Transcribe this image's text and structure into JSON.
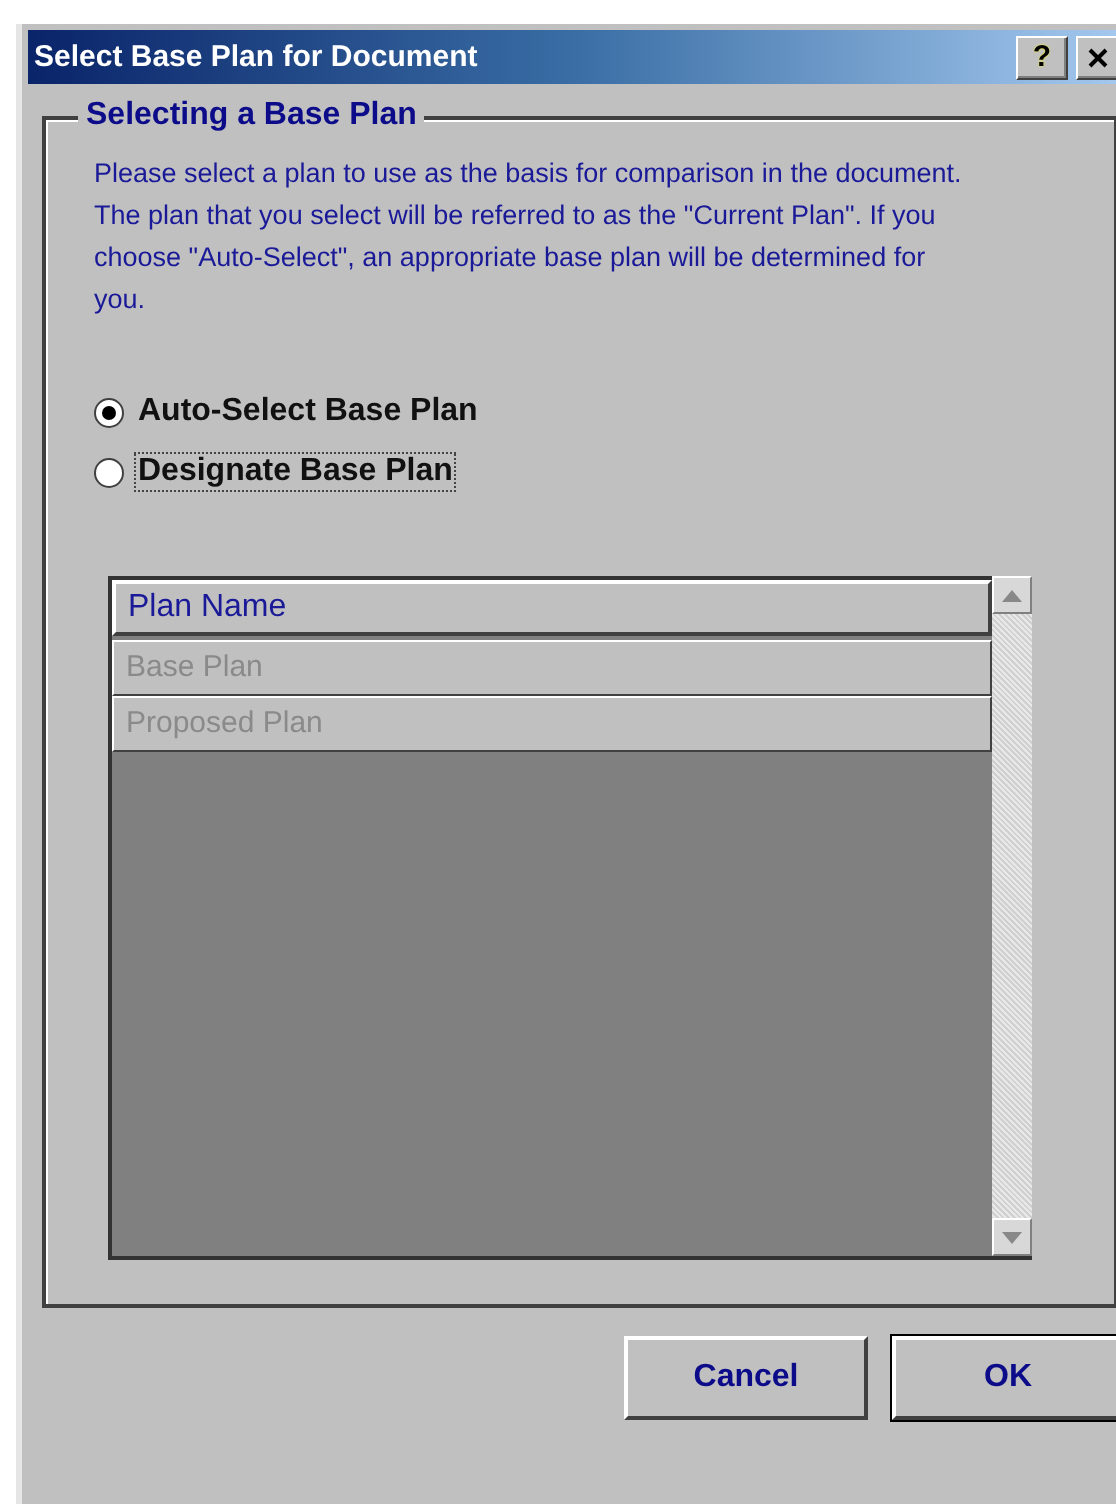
{
  "window": {
    "title": "Select Base Plan for Document",
    "help_button": "?"
  },
  "group": {
    "title": "Selecting a Base Plan",
    "description": "Please select a plan to use as the basis for comparison in the document. The plan that you select will be referred to as the \"Current Plan\". If you choose \"Auto-Select\", an appropriate base plan will be determined for you."
  },
  "options": [
    {
      "label": "Auto-Select Base Plan",
      "selected": true,
      "focused": false
    },
    {
      "label": "Designate Base Plan",
      "selected": false,
      "focused": true
    }
  ],
  "table": {
    "disabled": true,
    "columns": [
      "Plan Name"
    ],
    "rows": [
      "Base Plan",
      "Proposed Plan"
    ]
  },
  "buttons": [
    {
      "label": "Cancel",
      "default": false
    },
    {
      "label": "OK",
      "default": true
    }
  ]
}
